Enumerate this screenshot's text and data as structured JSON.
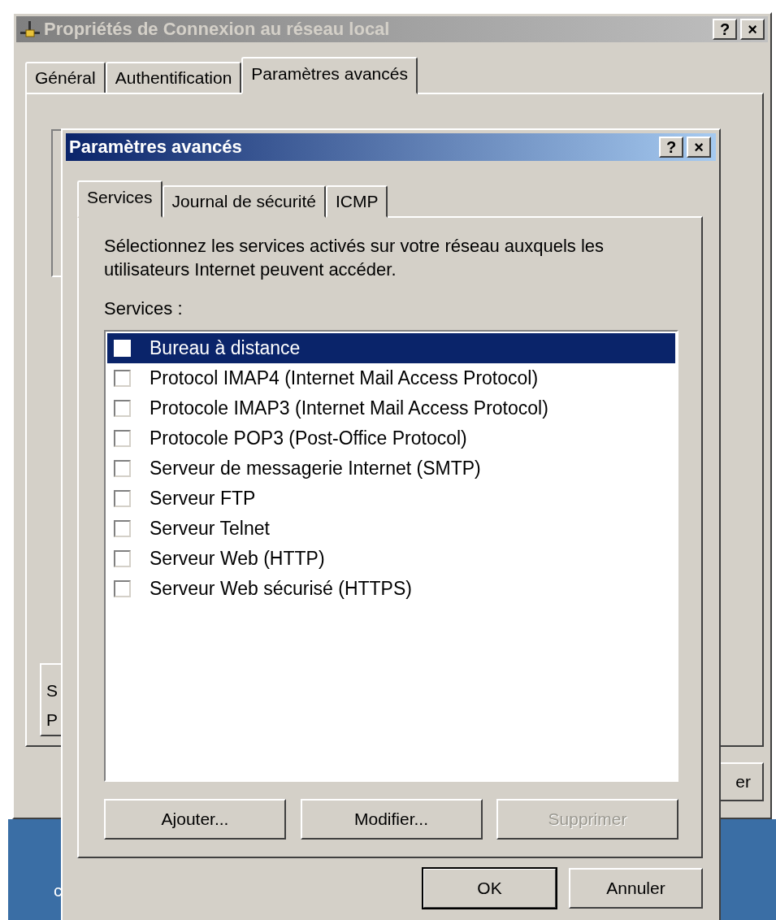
{
  "back_window": {
    "title": "Propriétés de Connexion au réseau local",
    "title_buttons": [
      "?",
      "×"
    ],
    "tabs": [
      {
        "label": "Général",
        "selected": false
      },
      {
        "label": "Authentification",
        "selected": false
      },
      {
        "label": "Paramètres avancés",
        "selected": true
      }
    ],
    "partial_texts": [
      "S",
      "P"
    ],
    "partial_button": "er"
  },
  "desktop": {
    "partial_text": "c"
  },
  "dialog": {
    "title": "Paramètres avancés",
    "title_buttons": [
      "?",
      "×"
    ],
    "tabs": [
      {
        "label": "Services",
        "selected": true
      },
      {
        "label": "Journal de sécurité",
        "selected": false
      },
      {
        "label": "ICMP",
        "selected": false
      }
    ],
    "description": "Sélectionnez les services activés sur votre réseau auxquels les utilisateurs Internet peuvent accéder.",
    "list_label": "Services :",
    "services": [
      {
        "label": "Bureau à distance",
        "checked": false,
        "selected": true
      },
      {
        "label": "Protocol IMAP4 (Internet Mail Access Protocol)",
        "checked": false,
        "selected": false
      },
      {
        "label": "Protocole IMAP3 (Internet Mail Access Protocol)",
        "checked": false,
        "selected": false
      },
      {
        "label": "Protocole POP3 (Post-Office Protocol)",
        "checked": false,
        "selected": false
      },
      {
        "label": "Serveur de messagerie Internet (SMTP)",
        "checked": false,
        "selected": false
      },
      {
        "label": "Serveur FTP",
        "checked": false,
        "selected": false
      },
      {
        "label": "Serveur Telnet",
        "checked": false,
        "selected": false
      },
      {
        "label": "Serveur Web (HTTP)",
        "checked": false,
        "selected": false
      },
      {
        "label": "Serveur Web sécurisé (HTTPS)",
        "checked": false,
        "selected": false
      }
    ],
    "list_buttons": [
      {
        "label": "Ajouter...",
        "disabled": false
      },
      {
        "label": "Modifier...",
        "disabled": false
      },
      {
        "label": "Supprimer",
        "disabled": true
      }
    ],
    "footer_buttons": [
      {
        "label": "OK",
        "default": true
      },
      {
        "label": "Annuler",
        "default": false
      }
    ]
  }
}
